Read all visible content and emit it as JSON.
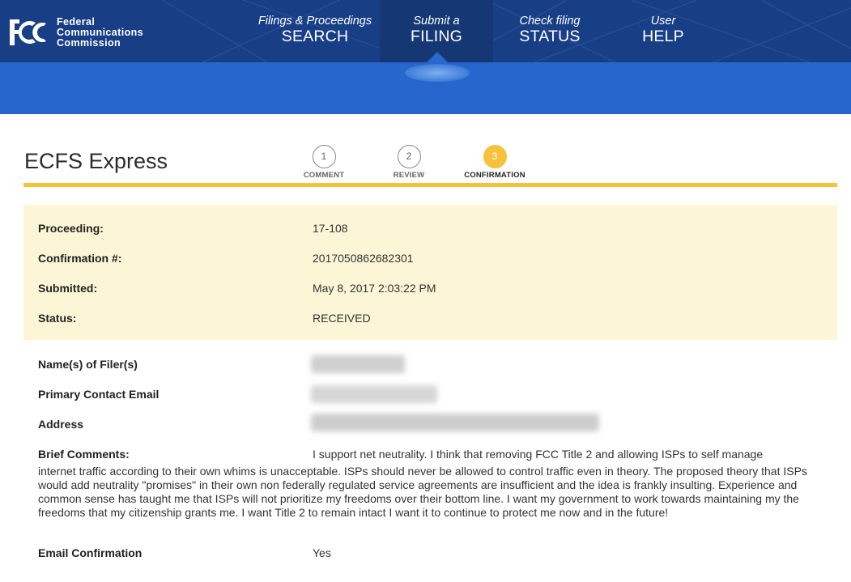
{
  "header": {
    "agency_lines": [
      "Federal",
      "Communications",
      "Commission"
    ],
    "nav": [
      {
        "small": "Filings & Proceedings",
        "big": "SEARCH"
      },
      {
        "small": "Submit a",
        "big": "FILING"
      },
      {
        "small": "Check filing",
        "big": "STATUS"
      },
      {
        "small": "User",
        "big": "HELP"
      }
    ],
    "colors": {
      "nav": "#183f86",
      "band": "#2766cc",
      "accent": "#f7c23b"
    }
  },
  "page": {
    "title": "ECFS Express",
    "steps": [
      {
        "number": "1",
        "label": "COMMENT"
      },
      {
        "number": "2",
        "label": "REVIEW"
      },
      {
        "number": "3",
        "label": "CONFIRMATION"
      }
    ]
  },
  "summary": {
    "proceeding_label": "Proceeding:",
    "proceeding_value": "17-108",
    "confirmation_label": "Confirmation #:",
    "confirmation_value": "2017050862682301",
    "submitted_label": "Submitted:",
    "submitted_value": "May 8, 2017 2:03:22 PM",
    "status_label": "Status:",
    "status_value": "RECEIVED"
  },
  "details": {
    "filer_label": "Name(s) of Filer(s)",
    "email_label": "Primary Contact Email",
    "address_label": "Address",
    "comments_label": "Brief Comments:",
    "comments_first_line": "I support net neutrality. I think that removing FCC Title 2 and allowing ISPs to self manage",
    "comments_rest": "internet traffic according to their own whims is unacceptable. ISPs should never be allowed to control traffic even in theory. The proposed theory that ISPs would add neutrality \"promises\" in their own non federally regulated service agreements are insufficient and the idea is frankly insulting. Experience and common sense has taught me that ISPs will not prioritize my freedoms over their bottom line. I want my government to work towards maintaining my the freedoms that my citizenship grants me. I want Title 2 to remain intact I want it to continue to protect me now and in the future!",
    "email_confirmation_label": "Email Confirmation",
    "email_confirmation_value": "Yes"
  }
}
